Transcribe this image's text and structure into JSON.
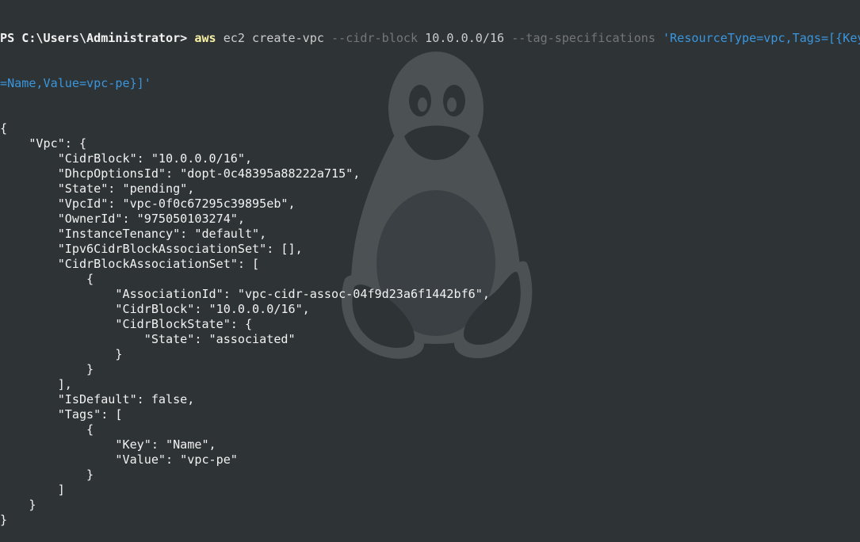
{
  "colors": {
    "background": "#2e3336",
    "foreground": "#f2f2f2",
    "command": "#f9f1a5",
    "flag": "#767676",
    "string": "#3a96dd",
    "watermark": "#4c5253"
  },
  "watermark_icon": "tux-penguin-icon",
  "command": {
    "prompt": "PS C:\\Users\\Administrator> ",
    "program": "aws",
    "service": " ec2 create-vpc ",
    "flag1": "--cidr-block",
    "value1": " 10.0.0.0/16 ",
    "flag2": "--tag-specifications",
    "value2_part1": " 'ResourceType=vpc,Tags=[{Key",
    "value2_part2": "=Name,Value=vpc-pe}]'"
  },
  "output_lines": [
    "{",
    "    \"Vpc\": {",
    "        \"CidrBlock\": \"10.0.0.0/16\",",
    "        \"DhcpOptionsId\": \"dopt-0c48395a88222a715\",",
    "        \"State\": \"pending\",",
    "        \"VpcId\": \"vpc-0f0c67295c39895eb\",",
    "        \"OwnerId\": \"975050103274\",",
    "        \"InstanceTenancy\": \"default\",",
    "        \"Ipv6CidrBlockAssociationSet\": [],",
    "        \"CidrBlockAssociationSet\": [",
    "            {",
    "                \"AssociationId\": \"vpc-cidr-assoc-04f9d23a6f1442bf6\",",
    "                \"CidrBlock\": \"10.0.0.0/16\",",
    "                \"CidrBlockState\": {",
    "                    \"State\": \"associated\"",
    "                }",
    "            }",
    "        ],",
    "        \"IsDefault\": false,",
    "        \"Tags\": [",
    "            {",
    "                \"Key\": \"Name\",",
    "                \"Value\": \"vpc-pe\"",
    "            }",
    "        ]",
    "    }",
    "}"
  ]
}
